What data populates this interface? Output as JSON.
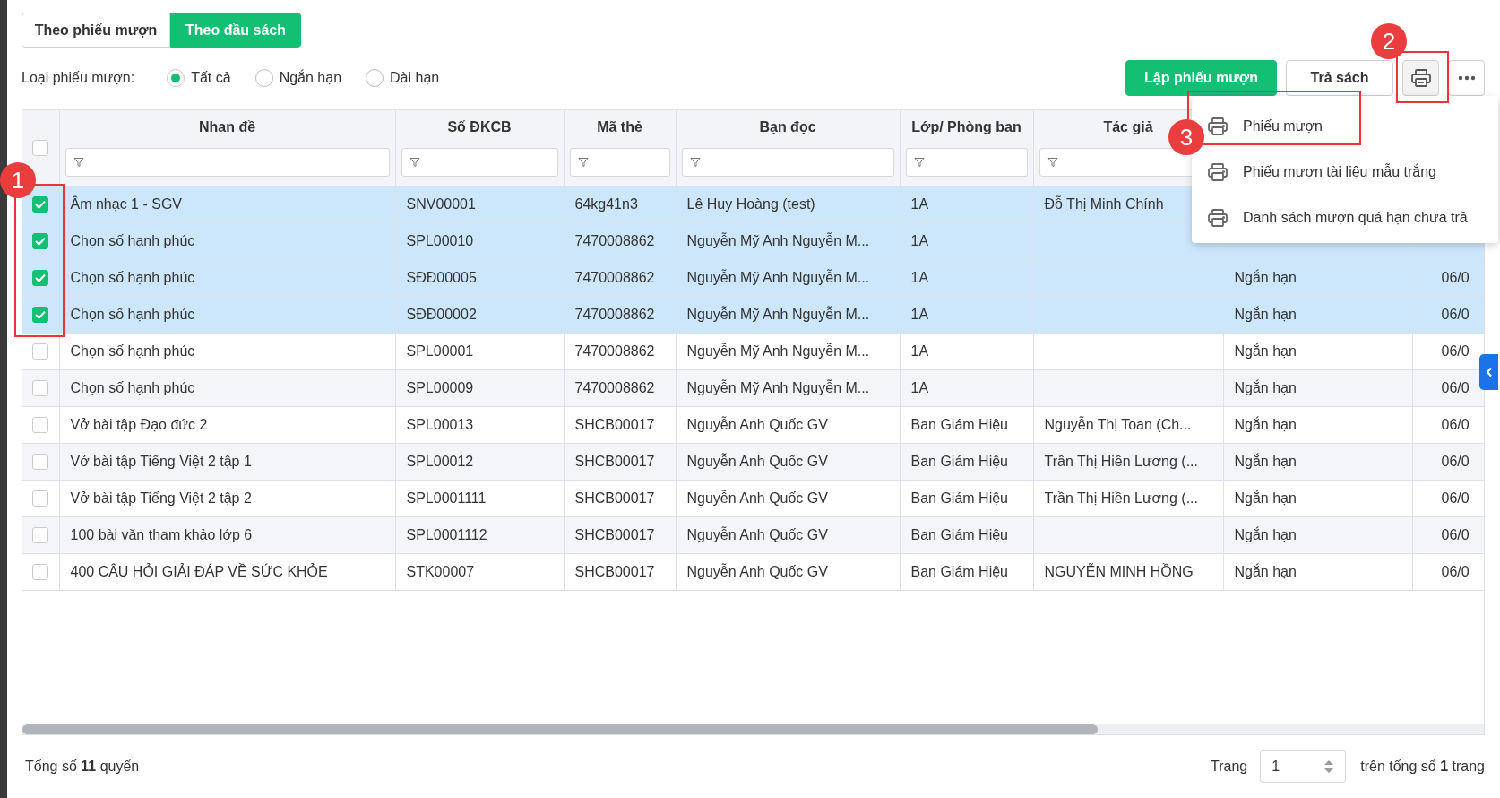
{
  "view_tabs": [
    {
      "label": "Theo phiếu mượn",
      "selected": false
    },
    {
      "label": "Theo đầu sách",
      "selected": true
    }
  ],
  "loan_type": {
    "label": "Loại phiếu mượn:",
    "options": [
      {
        "label": "Tất cả",
        "selected": true
      },
      {
        "label": "Ngắn hạn",
        "selected": false
      },
      {
        "label": "Dài hạn",
        "selected": false
      }
    ]
  },
  "actions": {
    "create": "Lập phiếu mượn",
    "return": "Trả sách"
  },
  "print_menu": {
    "items": [
      "Phiếu mượn",
      "Phiếu mượn tài liệu mẫu trắng",
      "Danh sách mượn quá hạn chưa trả"
    ]
  },
  "table": {
    "all_checked": false,
    "columns": [
      "Nhan đề",
      "Số ĐKCB",
      "Mã thẻ",
      "Bạn đọc",
      "Lớp/ Phòng ban",
      "Tác giả"
    ],
    "rows": [
      {
        "selected": true,
        "cells": [
          "Âm nhạc 1 - SGV",
          "SNV00001",
          "64kg41n3",
          "Lê Huy Hoàng (test)",
          "1A",
          "Đỗ Thị Minh Chính",
          null,
          null
        ]
      },
      {
        "selected": true,
        "cells": [
          "Chọn số hạnh phúc",
          "SPL00010",
          "7470008862",
          "Nguyễn Mỹ Anh Nguyễn M...",
          "1A",
          null,
          null,
          null
        ]
      },
      {
        "selected": true,
        "cells": [
          "Chọn số hạnh phúc",
          "SĐĐ00005",
          "7470008862",
          "Nguyễn Mỹ Anh Nguyễn M...",
          "1A",
          null,
          "Ngắn hạn",
          "06/0"
        ]
      },
      {
        "selected": true,
        "cells": [
          "Chọn số hạnh phúc",
          "SĐĐ00002",
          "7470008862",
          "Nguyễn Mỹ Anh Nguyễn M...",
          "1A",
          null,
          "Ngắn hạn",
          "06/0"
        ]
      },
      {
        "selected": false,
        "cells": [
          "Chọn số hạnh phúc",
          "SPL00001",
          "7470008862",
          "Nguyễn Mỹ Anh Nguyễn M...",
          "1A",
          null,
          "Ngắn hạn",
          "06/0"
        ]
      },
      {
        "selected": false,
        "cells": [
          "Chọn số hạnh phúc",
          "SPL00009",
          "7470008862",
          "Nguyễn Mỹ Anh Nguyễn M...",
          "1A",
          null,
          "Ngắn hạn",
          "06/0"
        ]
      },
      {
        "selected": false,
        "cells": [
          "Vở bài tập Đạo đức 2",
          "SPL00013",
          "SHCB00017",
          "Nguyễn Anh Quốc GV",
          "Ban Giám Hiệu",
          "Nguyễn Thị Toan (Ch...",
          "Ngắn hạn",
          "06/0"
        ]
      },
      {
        "selected": false,
        "cells": [
          "Vở bài tập Tiếng Việt 2 tập 1",
          "SPL00012",
          "SHCB00017",
          "Nguyễn Anh Quốc GV",
          "Ban Giám Hiệu",
          "Trần Thị Hiền Lương (...",
          "Ngắn hạn",
          "06/0"
        ]
      },
      {
        "selected": false,
        "cells": [
          "Vở bài tập Tiếng Việt 2 tập 2",
          "SPL0001111",
          "SHCB00017",
          "Nguyễn Anh Quốc GV",
          "Ban Giám Hiệu",
          "Trần Thị Hiền Lương (...",
          "Ngắn hạn",
          "06/0"
        ]
      },
      {
        "selected": false,
        "cells": [
          "100 bài văn tham khảo lớp 6",
          "SPL0001112",
          "SHCB00017",
          "Nguyễn Anh Quốc GV",
          "Ban Giám Hiệu",
          null,
          "Ngắn hạn",
          "06/0"
        ]
      },
      {
        "selected": false,
        "cells": [
          "400 CÂU HỎI GIẢI ĐÁP VỀ SỨC KHỎE",
          "STK00007",
          "SHCB00017",
          "Nguyễn Anh Quốc GV",
          "Ban Giám Hiệu",
          "NGUYỄN MINH HỒNG",
          "Ngắn hạn",
          "06/0"
        ]
      }
    ]
  },
  "footer": {
    "total": "Tổng số **11** quyển",
    "page_label": "Trang",
    "page": "1",
    "page_total": "trên tổng số **1** trang"
  },
  "annotations": [
    "1",
    "2",
    "3"
  ]
}
